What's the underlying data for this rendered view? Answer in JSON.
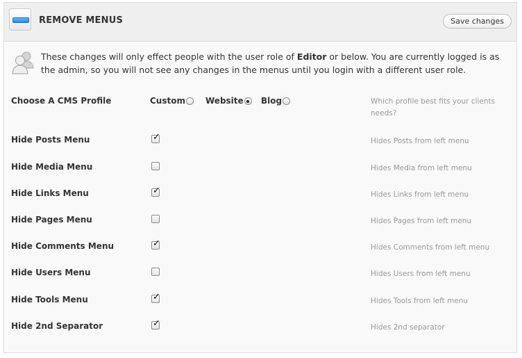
{
  "header": {
    "title": "REMOVE MENUS",
    "icon": "menu-bar-icon",
    "save_label": "Save changes"
  },
  "notice": {
    "icon": "users-icon",
    "text_before": "These changes will only effect people with the user role of ",
    "role": "Editor",
    "text_after": " or below. You are currently logged is as the admin, so you will not see any changes in the menus until you login with a different user role."
  },
  "profile": {
    "label": "Choose A CMS Profile",
    "options": [
      {
        "label": "Custom",
        "selected": false
      },
      {
        "label": "Website",
        "selected": true
      },
      {
        "label": "Blog",
        "selected": false
      }
    ],
    "help": "Which profile best fits your clients needs?"
  },
  "menus": [
    {
      "label": "Hide Posts Menu",
      "checked": true,
      "help": "Hides Posts from left menu"
    },
    {
      "label": "Hide Media Menu",
      "checked": false,
      "help": "Hides Media from left menu"
    },
    {
      "label": "Hide Links Menu",
      "checked": true,
      "help": "Hides Links from left menu"
    },
    {
      "label": "Hide Pages Menu",
      "checked": false,
      "help": "Hides Pages from left menu"
    },
    {
      "label": "Hide Comments Menu",
      "checked": true,
      "help": "Hides Comments from left menu"
    },
    {
      "label": "Hide Users Menu",
      "checked": false,
      "help": "Hides Users from left menu"
    },
    {
      "label": "Hide Tools Menu",
      "checked": true,
      "help": "Hides Tools from left menu"
    },
    {
      "label": "Hide 2nd Separator",
      "checked": true,
      "help": "Hides 2nd separator"
    }
  ],
  "colors": {
    "accent": "#1e8ee8",
    "help_text": "#999999",
    "panel_bg": "#f9f9f9",
    "header_bg": "#efefef"
  }
}
